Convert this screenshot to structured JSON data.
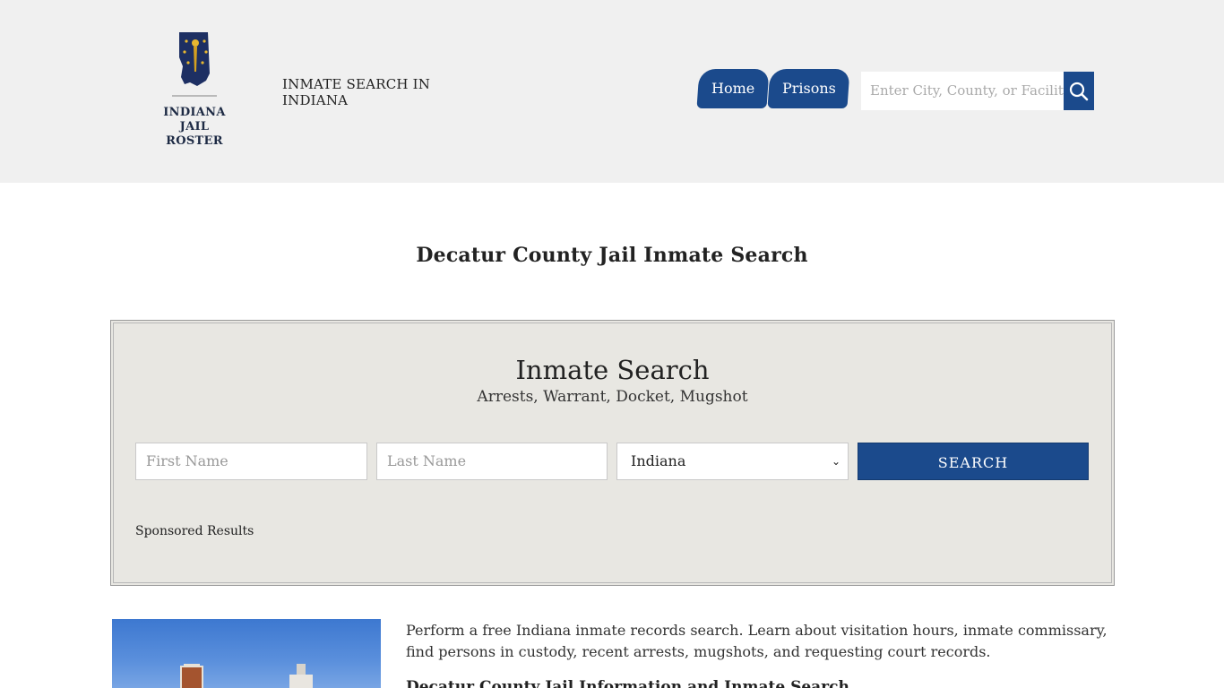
{
  "header": {
    "logo_text_line1": "INDIANA",
    "logo_text_line2": "JAIL ROSTER",
    "tagline": "INMATE SEARCH IN INDIANA",
    "nav": [
      {
        "label": "Home"
      },
      {
        "label": "Prisons"
      }
    ],
    "search_placeholder": "Enter City, County, or Facility"
  },
  "page_title": "Decatur County Jail Inmate Search",
  "search_panel": {
    "title": "Inmate Search",
    "subtitle": "Arrests, Warrant, Docket, Mugshot",
    "first_name_placeholder": "First Name",
    "last_name_placeholder": "Last Name",
    "state_selected": "Indiana",
    "submit_label": "SEARCH",
    "sponsored_label": "Sponsored Results"
  },
  "content": {
    "intro": "Perform a free Indiana inmate records search. Learn about visitation hours, inmate commissary, find persons in custody, recent arrests, mugshots, and requesting court records.",
    "section_heading": "Decatur County Jail Information and Inmate Search"
  },
  "colors": {
    "brand_blue": "#1b4a8c",
    "header_bg": "#f0f0f0",
    "panel_bg": "#e8e7e2"
  },
  "icons": {
    "search": "search-icon",
    "select": "chevron-down-icon"
  }
}
